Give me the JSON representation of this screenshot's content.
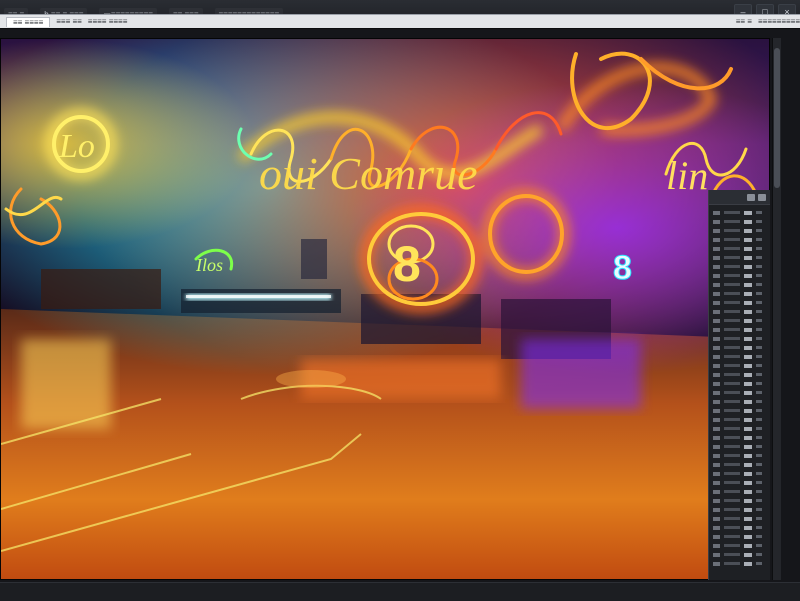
{
  "menu": {
    "items": [
      "≡≡ ≡",
      "b ≡≡ ≡ ≡≡≡",
      "▭≡≡≡≡≡≡≡≡≡",
      "≡≡ ≡≡≡",
      "≡≡≡≡≡≡≡≡≡≡≡≡≡",
      "≡≡ ≡",
      "≡≡≡≡≡≡≡≡≡"
    ]
  },
  "tabs": [
    "≡≡ ≡≡≡≡",
    "≡≡≡ ≡≡",
    "≡≡≡≡ ≡≡≡≡"
  ],
  "window_controls": {
    "minimize": "–",
    "maximize": "□",
    "close": "×"
  },
  "viewport": {
    "neon_text": [
      "Lo",
      "oui Comrue",
      "lin",
      "8",
      "8",
      "Ilos"
    ]
  },
  "colors": {
    "neon_yellow": "#ffe45a",
    "neon_orange": "#ff8a1f",
    "neon_red": "#ff3a2a",
    "neon_cyan": "#2de2ff",
    "neon_purple": "#8a2bff",
    "floor_orange": "#e06a12"
  },
  "icons": [
    "menu-icon",
    "minimize-icon",
    "maximize-icon",
    "close-icon"
  ]
}
